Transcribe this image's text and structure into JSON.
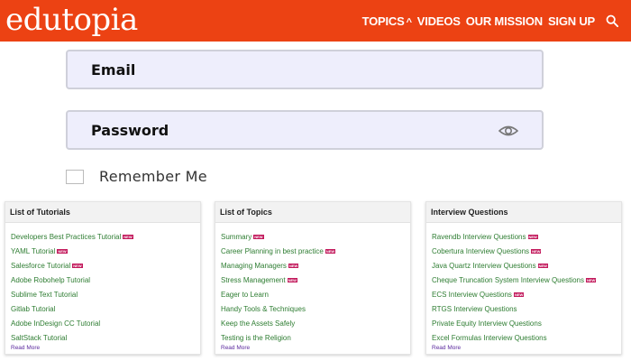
{
  "header": {
    "logo": "edutopia",
    "nav": [
      {
        "label": "TOPICS",
        "has_chevron": true
      },
      {
        "label": "VIDEOS"
      },
      {
        "label": "OUR MISSION"
      },
      {
        "label": "SIGN UP"
      }
    ]
  },
  "form": {
    "email_label": "Email",
    "password_label": "Password",
    "remember_label": "Remember Me"
  },
  "cards": [
    {
      "title": "List of Tutorials",
      "items": [
        {
          "text": "Developers Best Practices Tutorial",
          "badge": "NEW"
        },
        {
          "text": "YAML Tutorial",
          "badge": "NEW"
        },
        {
          "text": "Salesforce Tutorial",
          "badge": "NEW"
        },
        {
          "text": "Adobe Robohelp Tutorial"
        },
        {
          "text": "Sublime Text Tutorial"
        },
        {
          "text": "Gitlab Tutorial"
        },
        {
          "text": "Adobe InDesign CC Tutorial"
        },
        {
          "text": "SaltStack Tutorial"
        }
      ],
      "more": "Read More"
    },
    {
      "title": "List of Topics",
      "items": [
        {
          "text": "Summary",
          "badge": "NEW"
        },
        {
          "text": "Career Planning in best practice",
          "badge": "NEW"
        },
        {
          "text": "Managing Managers",
          "badge": "NEW"
        },
        {
          "text": "Stress Management",
          "badge": "NEW"
        },
        {
          "text": "Eager to Learn"
        },
        {
          "text": "Handy Tools & Techniques"
        },
        {
          "text": "Keep the Assets Safely"
        },
        {
          "text": "Testing is the Religion"
        }
      ],
      "more": "Read More"
    },
    {
      "title": "Interview Questions",
      "items": [
        {
          "text": "Ravendb Interview Questions",
          "badge": "NEW"
        },
        {
          "text": "Cobertura Interview Questions",
          "badge": "NEW"
        },
        {
          "text": "Java Quartz Interview Questions",
          "badge": "NEW"
        },
        {
          "text": "Cheque Truncation System Interview Questions",
          "badge": "NEW"
        },
        {
          "text": "ECS Interview Questions",
          "badge": "NEW"
        },
        {
          "text": "RTGS Interview Questions"
        },
        {
          "text": "Private Equity Interview Questions"
        },
        {
          "text": "Excel Formulas Interview Questions"
        }
      ],
      "more": "Read More"
    }
  ],
  "colors": {
    "brand": "#ec4213",
    "link_green": "#2e7d32",
    "badge": "#c2185b",
    "read_more": "#5b2a9e"
  },
  "icons": {
    "topics_chevron": "chevron-up-icon",
    "search": "search-icon",
    "password_toggle": "eye-icon"
  }
}
